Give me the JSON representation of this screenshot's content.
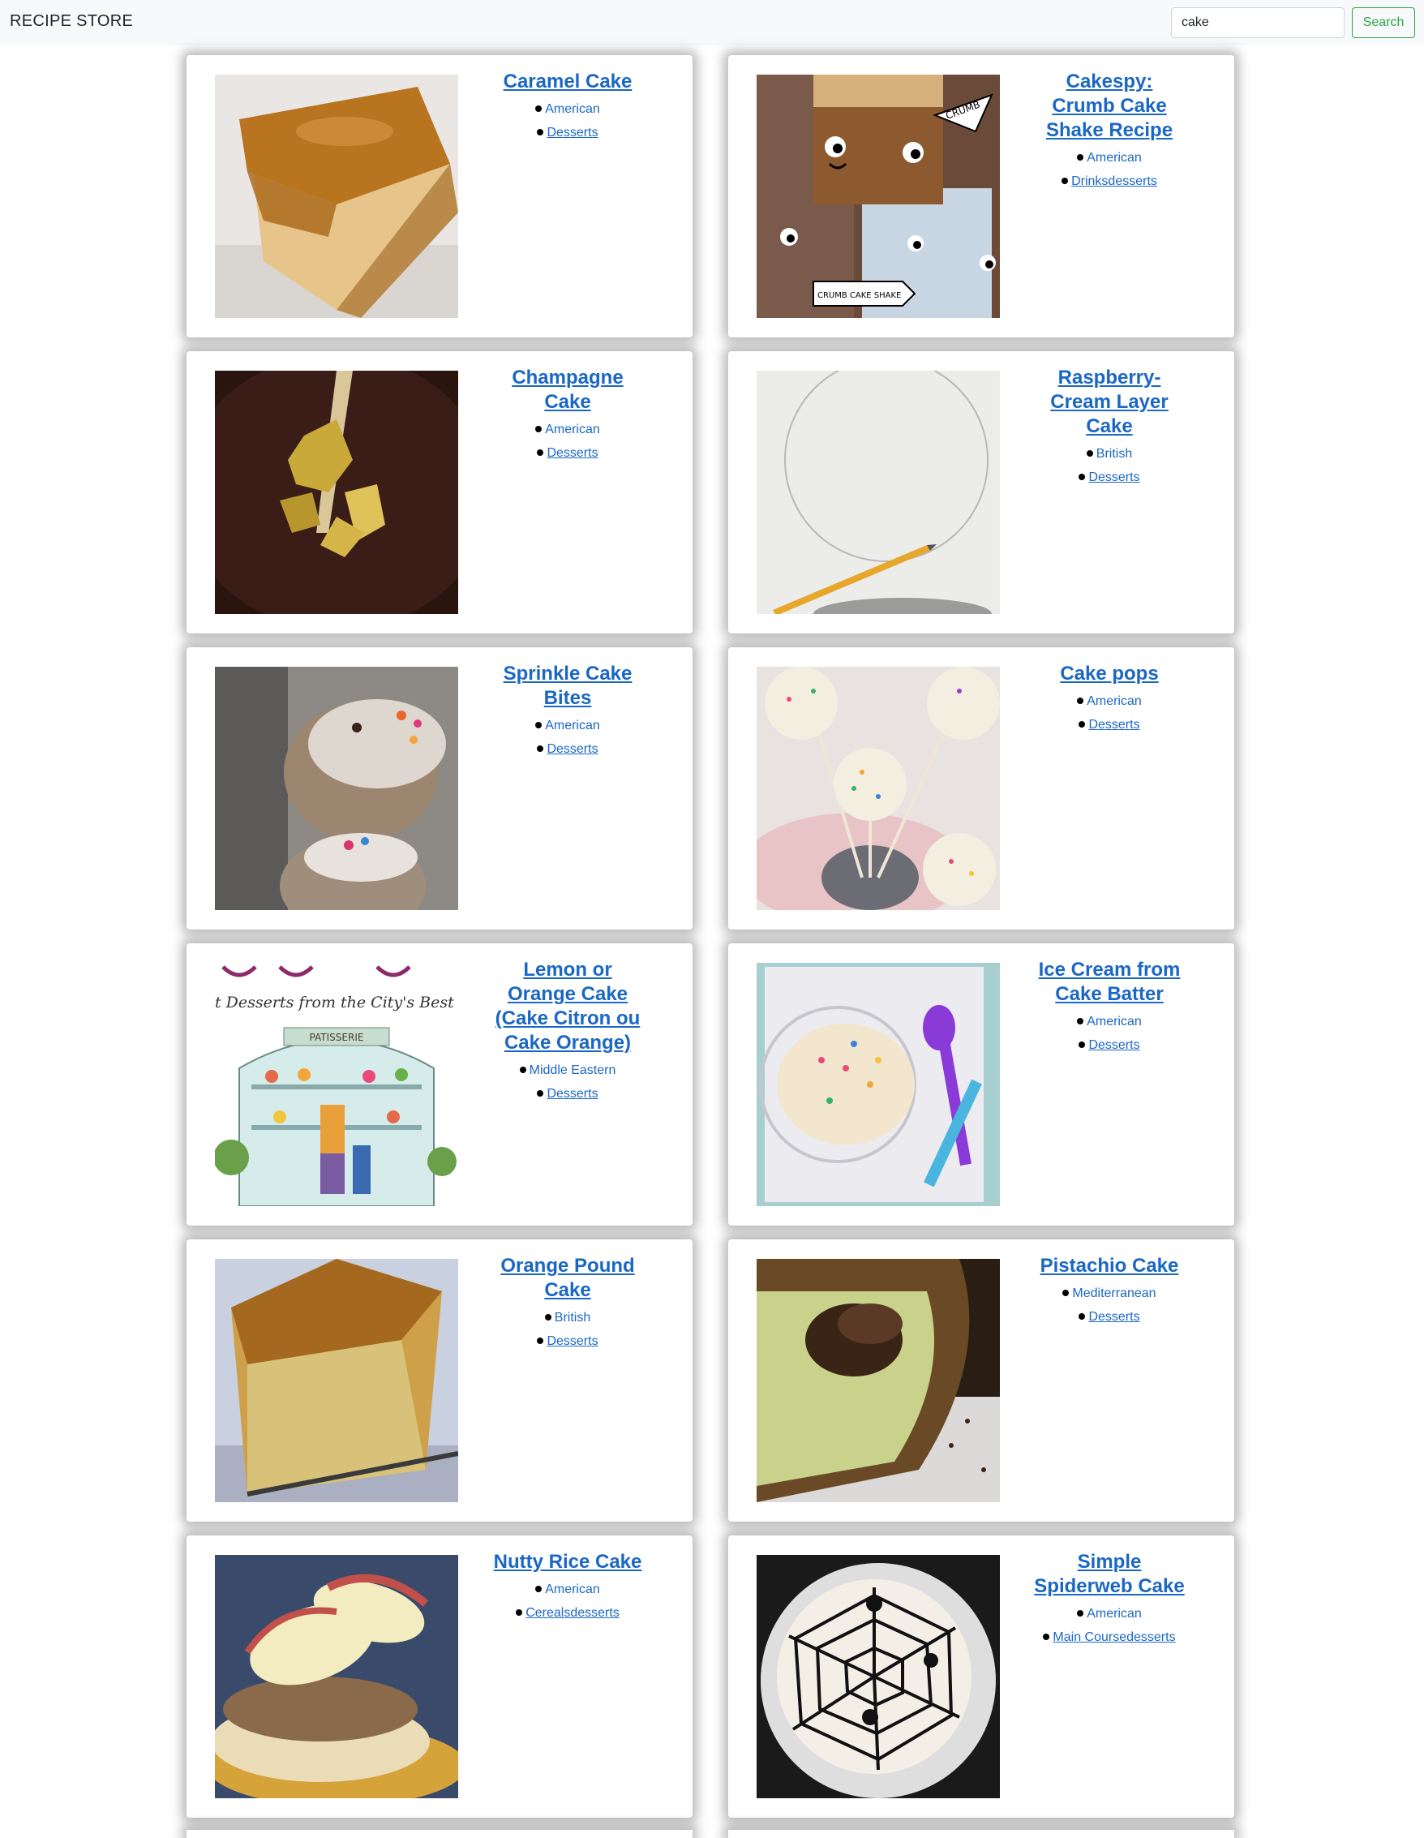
{
  "navbar": {
    "brand": "RECIPE STORE",
    "search_value": "cake",
    "search_button": "Search"
  },
  "recipes": [
    {
      "title": "Caramel Cake",
      "cuisine": "American",
      "category": "Desserts",
      "image": "caramel-cake-photo"
    },
    {
      "title": "Cakespy: Crumb Cake Shake Recipe",
      "cuisine": "American",
      "category": "Drinksdesserts",
      "image": "crumb-cake-shake-photo"
    },
    {
      "title": "Champagne Cake",
      "cuisine": "American",
      "category": "Desserts",
      "image": "champagne-cake-photo"
    },
    {
      "title": "Raspberry-Cream Layer Cake",
      "cuisine": "British",
      "category": "Desserts",
      "image": "raspberry-cream-layer-cake-photo"
    },
    {
      "title": "Sprinkle Cake Bites",
      "cuisine": "American",
      "category": "Desserts",
      "image": "sprinkle-cake-bites-photo"
    },
    {
      "title": "Cake pops",
      "cuisine": "American",
      "category": "Desserts",
      "image": "cake-pops-photo"
    },
    {
      "title": "Lemon or Orange Cake (Cake Citron ou Cake Orange)",
      "cuisine": "Middle Eastern",
      "category": "Desserts",
      "image": "patisserie-illustration"
    },
    {
      "title": "Ice Cream from Cake Batter",
      "cuisine": "American",
      "category": "Desserts",
      "image": "ice-cream-photo"
    },
    {
      "title": "Orange Pound Cake",
      "cuisine": "British",
      "category": "Desserts",
      "image": "orange-pound-cake-photo"
    },
    {
      "title": "Pistachio Cake",
      "cuisine": "Mediterranean",
      "category": "Desserts",
      "image": "pistachio-cake-photo"
    },
    {
      "title": "Nutty Rice Cake",
      "cuisine": "American",
      "category": "Cerealsdesserts",
      "image": "nutty-rice-cake-photo"
    },
    {
      "title": "Simple Spiderweb Cake",
      "cuisine": "American",
      "category": "Main Coursedesserts",
      "image": "spiderweb-cake-photo"
    }
  ],
  "overlay_text": {
    "crumb_label": "CRUMB",
    "crumb_cake_shake_label": "CRUMB CAKE SHAKE",
    "patisserie_tagline": "t Desserts from the City's Best Pastry S",
    "patisserie_sign": "PATISSERIE"
  }
}
